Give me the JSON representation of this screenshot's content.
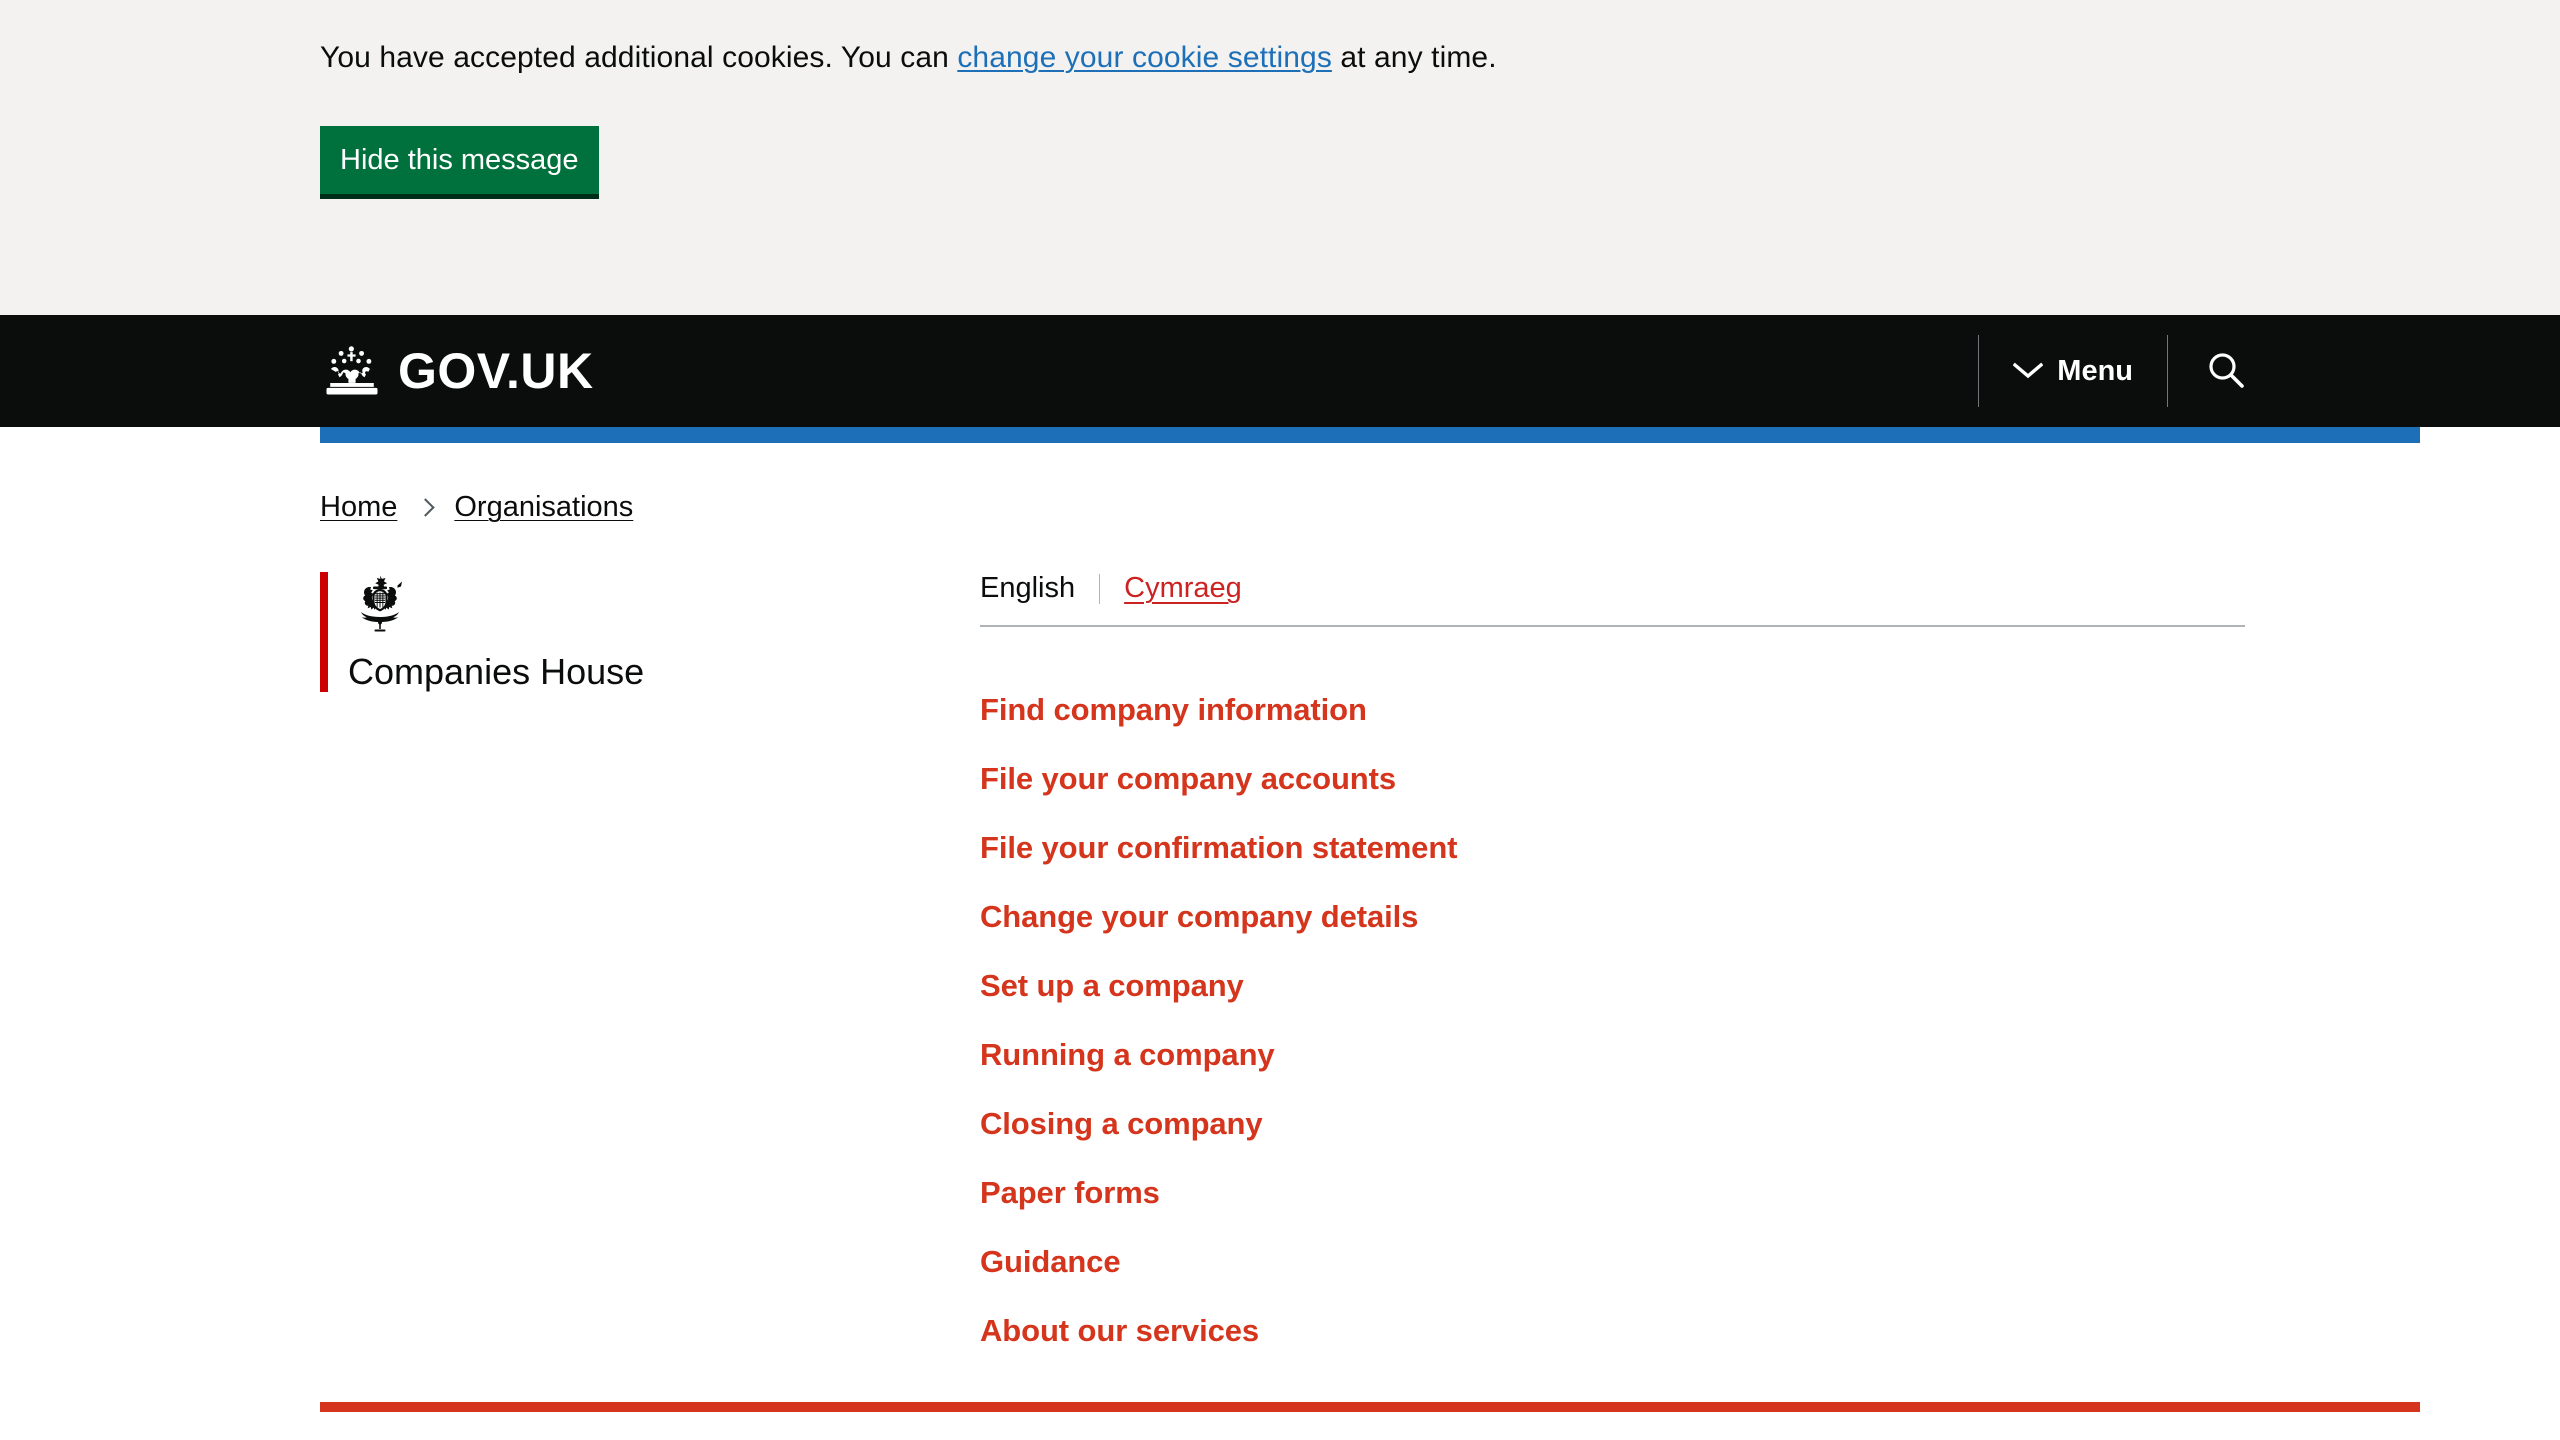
{
  "cookie_banner": {
    "text_before_link": "You have accepted additional cookies. You can ",
    "link_label": "change your cookie settings",
    "text_after_link": " at any time.",
    "hide_button_label": "Hide this message",
    "background_color": "#f3f2f1",
    "link_color": "#1d70b8",
    "button_color": "#00703c"
  },
  "header": {
    "logo_text": "GOV.UK",
    "crown_icon": "crown-icon",
    "menu_label": "Menu",
    "menu_icon": "chevron-down-icon",
    "search_icon": "search-icon",
    "background_color": "#0b0c0c",
    "accent_bar_color": "#1d70b8"
  },
  "breadcrumb": {
    "items": [
      {
        "label": "Home"
      },
      {
        "label": "Organisations"
      }
    ],
    "separator_icon": "chevron-right-icon"
  },
  "organisation": {
    "name": "Companies House",
    "crest_icon": "royal-coat-of-arms-icon",
    "accent_color": "#cc0000"
  },
  "language": {
    "active_label": "English",
    "alternate_label": "Cymraeg",
    "link_color": "#cc2222"
  },
  "nav": {
    "link_color": "#d4351c",
    "items": [
      {
        "label": "Find company information"
      },
      {
        "label": "File your company accounts"
      },
      {
        "label": "File your confirmation statement"
      },
      {
        "label": "Change your company details"
      },
      {
        "label": "Set up a company"
      },
      {
        "label": "Running a company"
      },
      {
        "label": "Closing a company"
      },
      {
        "label": "Paper forms"
      },
      {
        "label": "Guidance"
      },
      {
        "label": "About our services"
      }
    ]
  },
  "footer_rule": {
    "color": "#d4351c"
  }
}
